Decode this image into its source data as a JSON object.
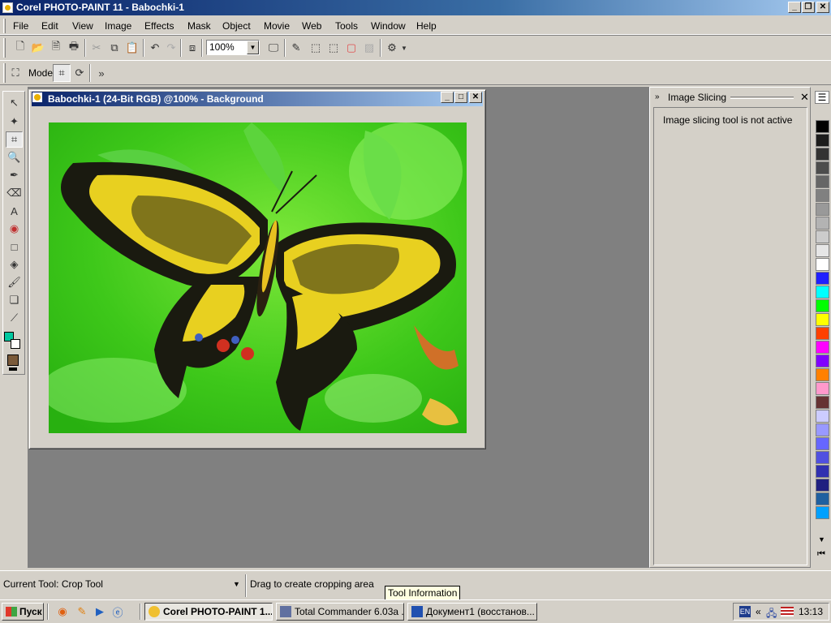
{
  "app": {
    "title": "Corel PHOTO-PAINT 11 - Babochki-1"
  },
  "caption_buttons": {
    "minimize": "_",
    "restore": "❐",
    "close": "✕"
  },
  "menu": [
    "File",
    "Edit",
    "View",
    "Image",
    "Effects",
    "Mask",
    "Object",
    "Movie",
    "Web",
    "Tools",
    "Window",
    "Help"
  ],
  "toolbar": {
    "zoom_value": "100%",
    "mode_label": "Mode"
  },
  "document": {
    "title": "Babochki-1 (24-Bit RGB) @100% - Background"
  },
  "docker": {
    "title": "Image Slicing",
    "message": "Image slicing tool is not active"
  },
  "status": {
    "current_tool": "Current Tool: Crop Tool",
    "hint": "Drag to create cropping area",
    "tooltip": "Tool Information"
  },
  "taskbar": {
    "start_label": "Пуск",
    "tasks": [
      {
        "label": "Corel PHOTO-PAINT 1...",
        "active": true
      },
      {
        "label": "Total Commander 6.03a ...",
        "active": false
      },
      {
        "label": "Документ1 (восстанов...",
        "active": false
      }
    ],
    "lang": "EN",
    "clock": "13:13"
  },
  "palette_colors": [
    "#000000",
    "#1c1c1c",
    "#333333",
    "#4d4d4d",
    "#666666",
    "#808080",
    "#999999",
    "#b3b3b3",
    "#cccccc",
    "#e6e6e6",
    "#ffffff",
    "#2020ff",
    "#00ffff",
    "#00ff00",
    "#ffff00",
    "#ff4000",
    "#ff00ff",
    "#8000ff",
    "#ff8000",
    "#ff99cc",
    "#663333",
    "#ccccff",
    "#9999ff",
    "#6666ff",
    "#5050e0",
    "#3030b0",
    "#202080",
    "#2060a0",
    "#00a0ff"
  ]
}
